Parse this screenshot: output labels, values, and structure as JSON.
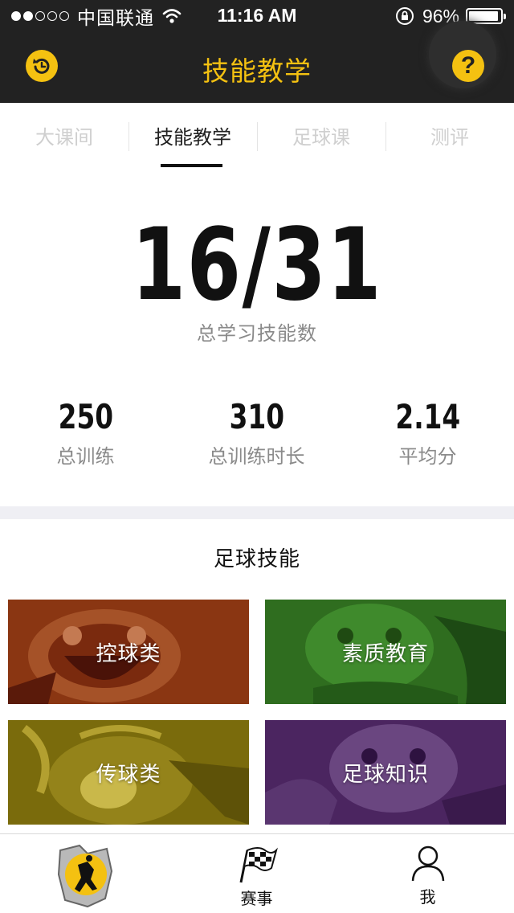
{
  "status_bar": {
    "carrier": "中国联通",
    "time": "11:16 AM",
    "battery_percent": "96%",
    "battery_level": 0.96,
    "signal_bars_filled": 2,
    "signal_bars_total": 5
  },
  "nav": {
    "title": "技能教学",
    "help_label": "?",
    "accent_color": "#f4c111",
    "left_icon": "refresh-icon"
  },
  "tabs": [
    {
      "label": "大课间",
      "active": false
    },
    {
      "label": "技能教学",
      "active": true
    },
    {
      "label": "足球课",
      "active": false
    },
    {
      "label": "测评",
      "active": false
    }
  ],
  "summary": {
    "skills_value": "16/31",
    "skills_label": "总学习技能数",
    "stats": [
      {
        "value": "250",
        "label": "总训练"
      },
      {
        "value": "310",
        "label": "总训练时长"
      },
      {
        "value": "2.14",
        "label": "平均分"
      }
    ]
  },
  "section": {
    "title": "足球技能"
  },
  "cards": [
    {
      "label": "控球类",
      "color": "#8a3612"
    },
    {
      "label": "素质教育",
      "color": "#2f6d1f"
    },
    {
      "label": "传球类",
      "color": "#7a6b0c"
    },
    {
      "label": "足球知识",
      "color": "#4b2560"
    }
  ],
  "tabbar": [
    {
      "label": "",
      "icon": "player-badge-icon"
    },
    {
      "label": "赛事",
      "icon": "checkered-flag-icon"
    },
    {
      "label": "我",
      "icon": "person-icon"
    }
  ]
}
